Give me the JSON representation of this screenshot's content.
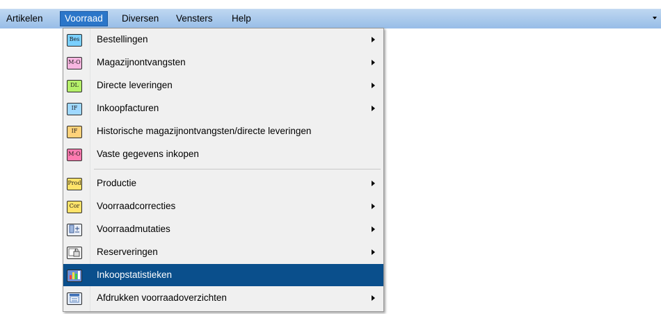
{
  "menubar": {
    "items": [
      {
        "label": "Artikelen",
        "access": "A"
      },
      {
        "label": "Voorraad",
        "access": "o"
      },
      {
        "label": "Diversen",
        "access": "i"
      },
      {
        "label": "Vensters",
        "access": "e"
      },
      {
        "label": "Help",
        "access": "H"
      }
    ],
    "dropdown_icon": "chevron-down-icon"
  },
  "menu": {
    "items": [
      {
        "label": "Bestellingen",
        "icon_text": "Bes",
        "icon_color": "#7ad0ff",
        "submenu": true
      },
      {
        "label": "Magazijnontvangsten",
        "icon_text": "M-O",
        "icon_color": "#f7b6e0",
        "submenu": true
      },
      {
        "label": "Directe leveringen",
        "icon_text": "DL",
        "icon_color": "#b5f06a",
        "submenu": true
      },
      {
        "label": "Inkoopfacturen",
        "icon_text": "IF",
        "icon_color": "#9fd8ff",
        "submenu": true
      },
      {
        "label": "Historische magazijnontvangsten/directe leveringen",
        "icon_text": "IF",
        "icon_color": "#ffd27a",
        "submenu": false
      },
      {
        "label": "Vaste gegevens inkopen",
        "icon_text": "M-O",
        "icon_color": "#ff7ab0",
        "submenu": false
      },
      {
        "label": "Productie",
        "icon_text": "Prod",
        "icon_color": "#ffe36a",
        "submenu": true
      },
      {
        "label": "Voorraadcorrecties",
        "icon_text": "Cor",
        "icon_color": "#ffe36a",
        "submenu": true
      },
      {
        "label": "Voorraadmutaties",
        "icon_text": "",
        "icon_color": "#e9eef7",
        "submenu": true
      },
      {
        "label": "Reserveringen",
        "icon_text": "",
        "icon_color": "#eeeeee",
        "submenu": true
      },
      {
        "label": "Inkoopstatistieken",
        "icon_text": "",
        "icon_color": "#6b8fd6",
        "submenu": false
      },
      {
        "label": "Afdrukken voorraadoverzichten",
        "icon_text": "",
        "icon_color": "#dfe8f5",
        "submenu": true
      }
    ]
  },
  "colors": {
    "highlight": "#0a4f8c",
    "menubar_active": "#2b76c9"
  }
}
